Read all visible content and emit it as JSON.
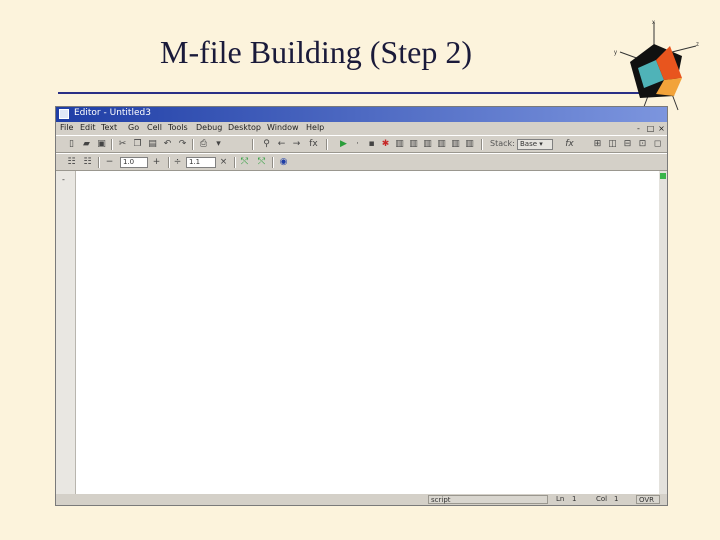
{
  "slide": {
    "title": "M-file Building (Step 2)"
  },
  "window": {
    "title": "Editor - Untitled3",
    "controls": {
      "minimize": "-",
      "restore": "□",
      "close": "×"
    }
  },
  "menu": [
    "File",
    "Edit",
    "Text",
    "Go",
    "Cell",
    "Tools",
    "Debug",
    "Desktop",
    "Window",
    "Help"
  ],
  "toolbar1": {
    "stack_label": "Stack:",
    "stack_value": "Base",
    "fx": "fx"
  },
  "toolbar2": {
    "minus": "−",
    "value1": "1.0",
    "plus": "+",
    "divide": "÷",
    "value2": "1.1"
  },
  "status": {
    "mode": "script",
    "ln_label": "Ln",
    "ln_value": "1",
    "col_label": "Col",
    "col_value": "1",
    "ovr": "OVR"
  },
  "icons": [
    "new-file-icon",
    "open-folder-icon",
    "save-icon",
    "cut-icon",
    "copy-icon",
    "paste-icon",
    "undo-icon",
    "redo-icon",
    "print-icon",
    "find-icon",
    "back-icon",
    "forward-icon",
    "function-icon",
    "run-icon",
    "breakpoint-icon",
    "clear-breakpoints-icon",
    "step-icon",
    "step-in-icon",
    "step-out-icon",
    "continue-icon",
    "exit-debug-icon",
    "tile-icon",
    "split-horizontal-icon",
    "split-vertical-icon",
    "float-icon",
    "dock-icon"
  ],
  "colors": {
    "titlebar_start": "#1f3ea6",
    "titlebar_end": "#7c95de",
    "rule": "#2a2f86",
    "background": "#fcf3dc"
  }
}
